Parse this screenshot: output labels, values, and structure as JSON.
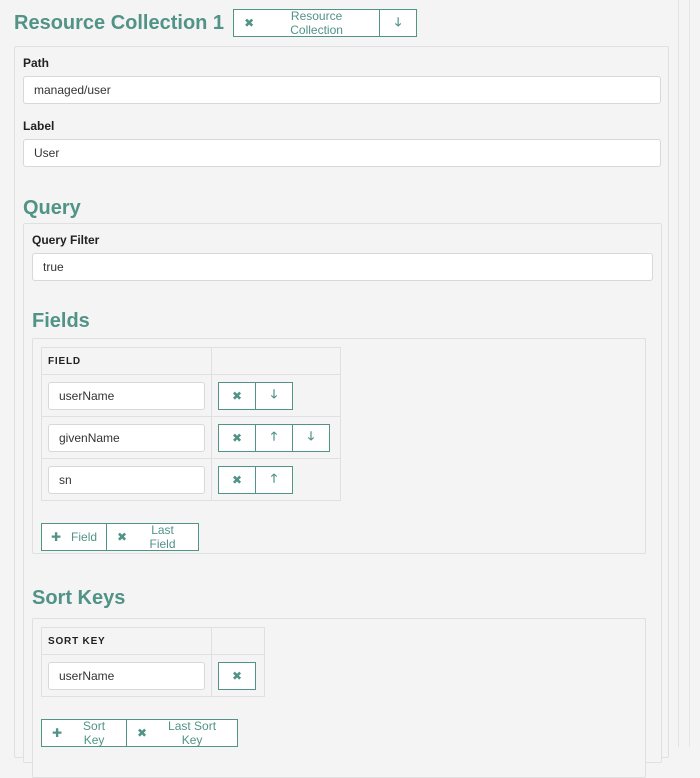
{
  "header": {
    "title": "Resource Collection 1",
    "collection_button_label": "Resource Collection"
  },
  "collection": {
    "path_label": "Path",
    "path_value": "managed/user",
    "label_label": "Label",
    "label_value": "User"
  },
  "query": {
    "title": "Query",
    "filter_label": "Query Filter",
    "filter_value": "true"
  },
  "fields": {
    "title": "Fields",
    "column_header": "FIELD",
    "rows": [
      {
        "value": "userName",
        "actions": [
          "remove",
          "move-down"
        ]
      },
      {
        "value": "givenName",
        "actions": [
          "remove",
          "move-up",
          "move-down"
        ]
      },
      {
        "value": "sn",
        "actions": [
          "remove",
          "move-up"
        ]
      }
    ],
    "add_label": "Field",
    "remove_last_label": "Last Field"
  },
  "sort_keys": {
    "title": "Sort Keys",
    "column_header": "SORT KEY",
    "rows": [
      {
        "value": "userName",
        "actions": [
          "remove"
        ]
      }
    ],
    "add_label": "Sort Key",
    "remove_last_label": "Last Sort Key"
  },
  "icons": {
    "remove": "✖",
    "move-up": "🡑",
    "move-down": "🡓",
    "add": "✚"
  },
  "colors": {
    "accent": "#519387",
    "background": "#f4f4f4",
    "border": "#e0e0e0"
  }
}
